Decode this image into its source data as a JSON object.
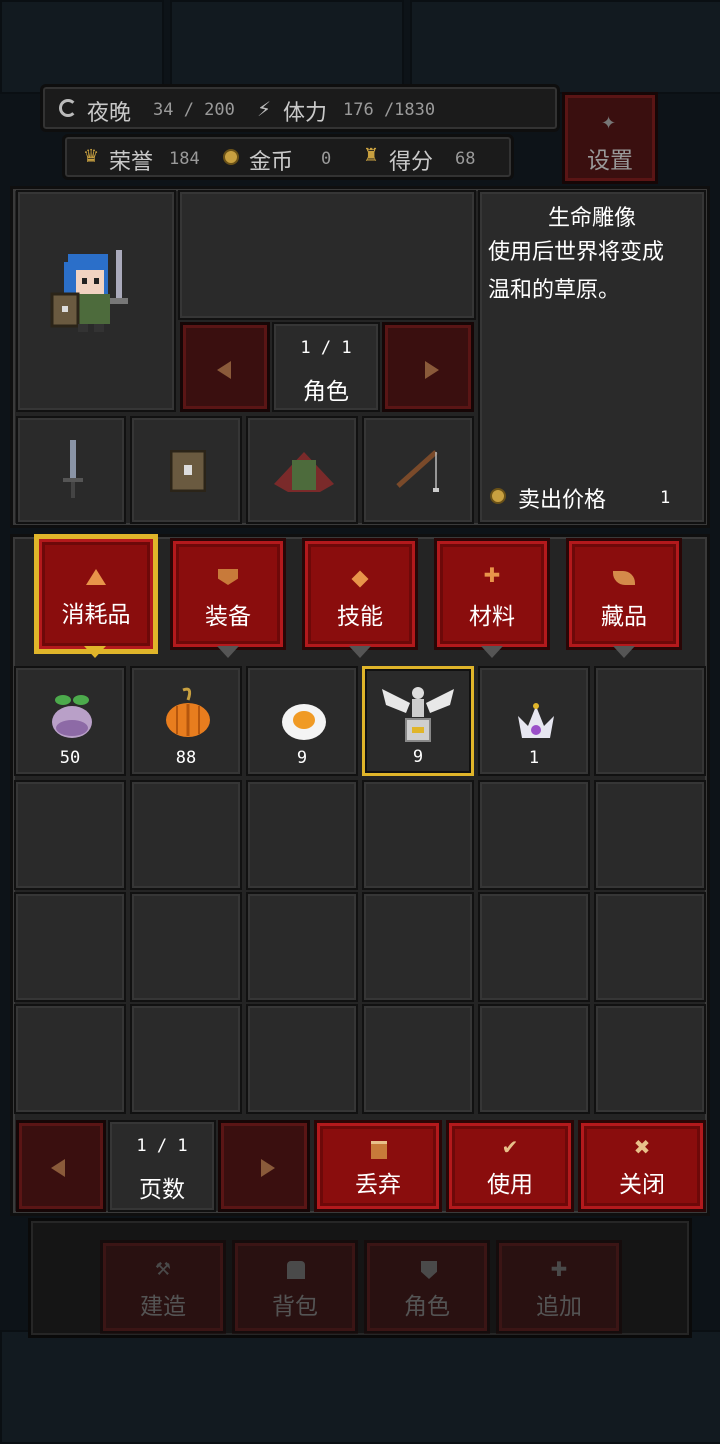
{
  "hud": {
    "night_label": "夜晚",
    "night_value": "34 / 200",
    "stamina_label": "体力",
    "stamina_value": "176 /1830",
    "honor_label": "荣誉",
    "honor_value": "184",
    "gold_label": "金币",
    "gold_value": "0",
    "score_label": "得分",
    "score_value": "68",
    "settings_label": "设置"
  },
  "character": {
    "page": "1 / 1",
    "label": "角色",
    "equipment": [
      "sword-icon",
      "shield-icon",
      "cloak-icon",
      "fishing-rod-icon"
    ]
  },
  "item_info": {
    "name": "生命雕像",
    "desc_line1": "使用后世界将变成",
    "desc_line2": "温和的草原。",
    "sell_label": "卖出价格",
    "sell_value": "1"
  },
  "tabs": [
    {
      "label": "消耗品",
      "icon": "flask-icon",
      "active": true
    },
    {
      "label": "装备",
      "icon": "armor-icon",
      "active": false
    },
    {
      "label": "技能",
      "icon": "diamond-icon",
      "active": false
    },
    {
      "label": "材料",
      "icon": "plus-icon",
      "active": false
    },
    {
      "label": "藏品",
      "icon": "leaf-icon",
      "active": false
    }
  ],
  "inventory": [
    {
      "icon": "turnip-icon",
      "count": "50"
    },
    {
      "icon": "pumpkin-icon",
      "count": "88"
    },
    {
      "icon": "fried-egg-icon",
      "count": "9"
    },
    {
      "icon": "winged-statue-icon",
      "count": "9",
      "selected": true
    },
    {
      "icon": "crown-icon",
      "count": "1"
    }
  ],
  "footer": {
    "page": "1 / 1",
    "page_label": "页数",
    "discard_label": "丢弃",
    "use_label": "使用",
    "close_label": "关闭"
  },
  "bottom_nav": [
    "建造",
    "背包",
    "角色",
    "追加"
  ],
  "colors": {
    "accent_red": "#8a0d0d",
    "highlight_gold": "#e0b52a",
    "panel": "#242424"
  }
}
